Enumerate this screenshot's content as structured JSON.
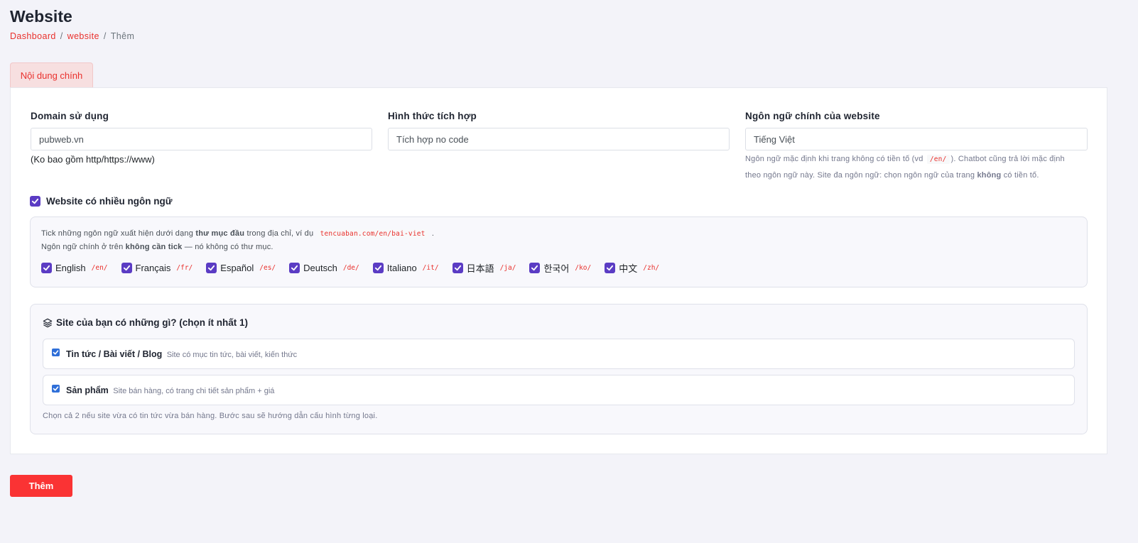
{
  "page": {
    "title": "Website"
  },
  "breadcrumb": {
    "home": "Dashboard",
    "section": "website",
    "current": "Thêm",
    "separator": "/"
  },
  "tabs": [
    {
      "label": "Nội dung chính",
      "active": true
    }
  ],
  "form": {
    "domain": {
      "label": "Domain sử dụng",
      "value": "pubweb.vn",
      "hint": "(Ko bao gồm http/https://www)"
    },
    "integration": {
      "label": "Hình thức tích hợp",
      "value": "Tích hợp no code"
    },
    "main_language": {
      "label": "Ngôn ngữ chính của website",
      "value": "Tiếng Việt",
      "hint_part1": "Ngôn ngữ mặc định khi trang không có tiền tố (vd",
      "hint_code": "/en/",
      "hint_part2": "). Chatbot cũng trả lời mặc định",
      "hint_line2_a": "theo ngôn ngữ này. Site đa ngôn ngữ: chọn ngôn ngữ của trang",
      "hint_line2_b": "không",
      "hint_line2_c": "có tiền tố."
    },
    "multilang": {
      "label": "Website có nhiều ngôn ngữ",
      "checked": true,
      "note_a": "Tick những ngôn ngữ xuất hiện dưới dạng",
      "note_b": "thư mục đầu",
      "note_c": "trong địa chỉ, ví dụ",
      "note_code": "tencuaban.com/en/bai-viet",
      "note_d": ".",
      "note2_a": "Ngôn ngữ chính ở trên",
      "note2_b": "không cần tick",
      "note2_c": "— nó không có thư mục.",
      "languages": [
        {
          "name": "English",
          "path": "/en/",
          "checked": true
        },
        {
          "name": "Français",
          "path": "/fr/",
          "checked": true
        },
        {
          "name": "Español",
          "path": "/es/",
          "checked": true
        },
        {
          "name": "Deutsch",
          "path": "/de/",
          "checked": true
        },
        {
          "name": "Italiano",
          "path": "/it/",
          "checked": true
        },
        {
          "name": "日本語",
          "path": "/ja/",
          "checked": true
        },
        {
          "name": "한국어",
          "path": "/ko/",
          "checked": true
        },
        {
          "name": "中文",
          "path": "/zh/",
          "checked": true
        }
      ]
    },
    "site_types": {
      "title": "Site của bạn có những gì? (chọn ít nhất 1)",
      "icon": "layers-icon",
      "options": [
        {
          "title": "Tin tức / Bài viết / Blog",
          "desc": "Site có mục tin tức, bài viết, kiến thức",
          "checked": true
        },
        {
          "title": "Sản phẩm",
          "desc": "Site bán hàng, có trang chi tiết sản phẩm + giá",
          "checked": true
        }
      ],
      "footnote": "Chọn cả 2 nếu site vừa có tin tức vừa bán hàng. Bước sau sẽ hướng dẫn cấu hình từng loại."
    }
  },
  "actions": {
    "submit_label": "Thêm"
  },
  "colors": {
    "accent": "#e9302c",
    "button": "#fa3334",
    "checkbox": "#5b3cc4",
    "checkbox_small": "#2f6fd8"
  }
}
